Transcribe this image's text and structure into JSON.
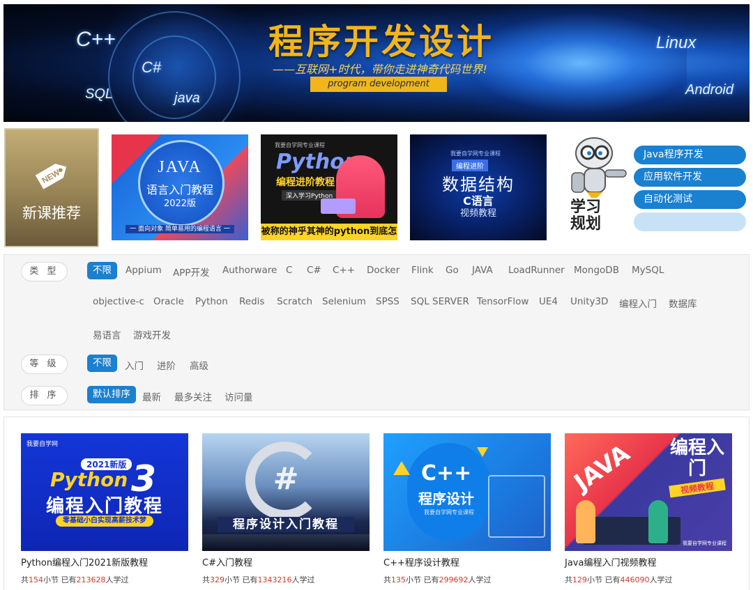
{
  "hero": {
    "languages": [
      "C++",
      "C#",
      "SQL",
      "java",
      "Linux",
      "Android"
    ],
    "title": "程序开发设计",
    "subtitle": "——互联网+时代，带你走进神奇代码世界!",
    "tag": "program development"
  },
  "featured": {
    "new_label": "新课推荐",
    "new_icon_text": "NEW",
    "cards": [
      {
        "title": "JAVA",
        "subtitle": "语言入门教程",
        "year": "2022版",
        "band": "一 面向对象 简单易用的编程语言 一"
      },
      {
        "head": "我要自学网专业课程",
        "title": "Python",
        "subtitle": "编程进阶教程",
        "tag": "深入学习Python",
        "bottom": "被称的神乎其神的python到底怎样?"
      },
      {
        "head": "我要自学网专业课程",
        "badge": "编程进阶",
        "title": "数据结构",
        "subtitle": "C语言",
        "subtitle2": "视频教程"
      }
    ]
  },
  "study_plan": {
    "label": "学习规划",
    "items": [
      "Java程序开发",
      "应用软件开发",
      "自动化测试",
      ""
    ]
  },
  "filters": {
    "type_label": "类 型",
    "type_options": [
      "不限",
      "Appium",
      "APP开发",
      "Authorware",
      "C",
      "C#",
      "C++",
      "Docker",
      "Flink",
      "Go",
      "JAVA",
      "LoadRunner",
      "MongoDB",
      "MySQL",
      "objective-c",
      "Oracle",
      "Python",
      "Redis",
      "Scratch",
      "Selenium",
      "SPSS",
      "SQL SERVER",
      "TensorFlow",
      "UE4",
      "Unity3D",
      "编程入门",
      "数据库",
      "易语言",
      "游戏开发"
    ],
    "level_label": "等 级",
    "level_options": [
      "不限",
      "入门",
      "进阶",
      "高级"
    ],
    "sort_label": "排 序",
    "sort_options": [
      "默认排序",
      "最新",
      "最多关注",
      "访问量"
    ]
  },
  "courses": [
    {
      "name": "Python编程入门2021新版教程",
      "lessons": "154",
      "learners": "213628",
      "art": {
        "logo": "我要自学网",
        "year": "2021新版",
        "python": "Python",
        "num": "3",
        "title": "编程入门教程",
        "tag": "零基础小白实现高薪技术梦"
      }
    },
    {
      "name": "C#入门教程",
      "lessons": "329",
      "learners": "1343216",
      "art": {
        "hash": "#",
        "title": "程序设计入门教程"
      }
    },
    {
      "name": "C++程序设计教程",
      "lessons": "135",
      "learners": "299692",
      "art": {
        "cpp": "C++",
        "title": "程序设计",
        "small": "我要自学网专业课程"
      }
    },
    {
      "name": "Java编程入门视频教程",
      "lessons": "129",
      "learners": "446090",
      "art": {
        "java": "JAVA",
        "vert": "编程入门",
        "tag": "视频教程",
        "foot": "我要自学网专业课程"
      }
    }
  ],
  "labels": {
    "prefix": "共",
    "lessons_unit": "小节 已有",
    "learners_unit": "人学过"
  },
  "colors": {
    "accent": "#1a80d0",
    "highlight": "#d33a2c",
    "gold": "#f2b51a"
  }
}
